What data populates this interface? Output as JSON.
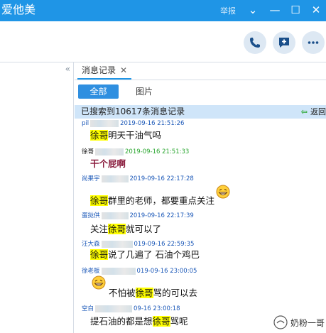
{
  "window": {
    "title": "爱他美",
    "report_label": "举报",
    "controls": [
      "⌄",
      "—",
      "☐",
      "✕"
    ]
  },
  "toolbar": {
    "icons": [
      "phone-icon",
      "message-add-icon",
      "more-icon"
    ]
  },
  "left_pane": {
    "arrow": "«"
  },
  "tab": {
    "label": "消息记录",
    "close": "✕"
  },
  "filters": {
    "all": "全部",
    "images": "图片"
  },
  "search": {
    "result_text": "已搜索到10617条消息记录",
    "back_label": "返回"
  },
  "messages": [
    {
      "name": "pil",
      "time": "2019-09-16 21:51:26",
      "parts": [
        [
          "徐哥",
          true
        ],
        [
          "明天干油气吗",
          false
        ]
      ],
      "emoji_before": false,
      "emoji_after": false,
      "bold": false
    },
    {
      "name": "徐哥",
      "time": "2019-09-16 21:51:33",
      "parts": [
        [
          "干个屁啊",
          false
        ]
      ],
      "emoji_before": false,
      "emoji_after": false,
      "bold": true
    },
    {
      "name": "尚果宇",
      "time": "2019-09-16 22:17:28",
      "parts": [
        [
          "徐哥",
          true
        ],
        [
          "群里的老师，都要重点关注",
          false
        ]
      ],
      "emoji_before": false,
      "emoji_after": true,
      "bold": false
    },
    {
      "name": "蛋挞供",
      "time": "2019-09-16 22:17:39",
      "parts": [
        [
          "关注",
          false
        ],
        [
          "徐哥",
          true
        ],
        [
          "就可以了",
          false
        ]
      ],
      "emoji_before": false,
      "emoji_after": false,
      "bold": false
    },
    {
      "name": "汪大森",
      "time": "019-09-16 22:59:35",
      "parts": [
        [
          "徐哥",
          true
        ],
        [
          "说了几遍了 石油个鸡巴",
          false
        ]
      ],
      "emoji_before": false,
      "emoji_after": false,
      "bold": false
    },
    {
      "name": "徐老板",
      "time": "019-09-16 23:00:05",
      "parts": [
        [
          "不怕被",
          false
        ],
        [
          "徐哥",
          true
        ],
        [
          "骂的可以去",
          false
        ]
      ],
      "emoji_before": true,
      "emoji_after": false,
      "bold": false
    },
    {
      "name": "空白",
      "time": "09-16 23:00:18",
      "parts": [
        [
          "提石油的都是想",
          false
        ],
        [
          "徐哥",
          true
        ],
        [
          "骂呢",
          false
        ]
      ],
      "emoji_before": false,
      "emoji_after": false,
      "bold": false
    }
  ],
  "watermark": {
    "text": "奶粉一哥"
  },
  "colors": {
    "titlebar": "#1f95e6",
    "accent": "#2f8fe0",
    "highlight": "#ffff00",
    "name": "#1b58b8",
    "time_self": "#27a52d"
  }
}
